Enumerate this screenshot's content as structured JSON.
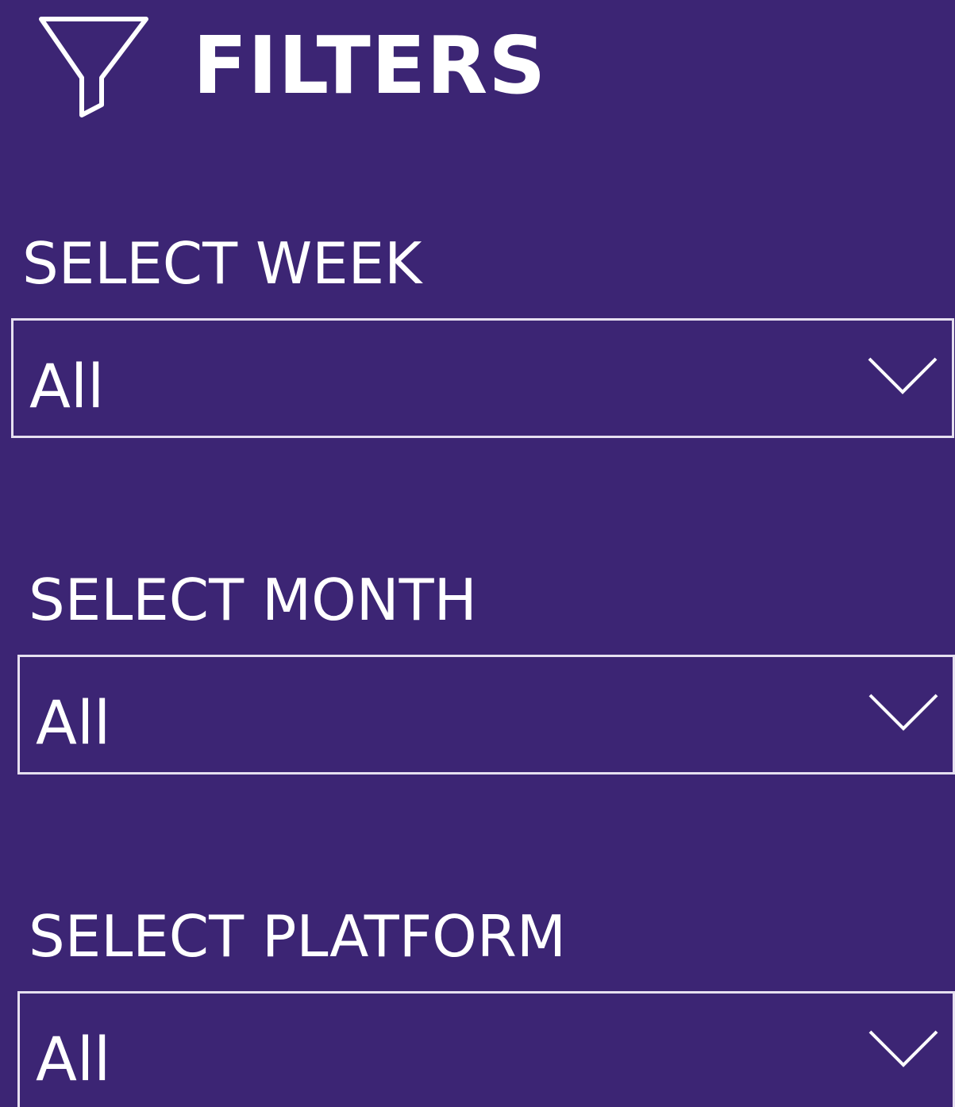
{
  "header": {
    "title": "FILTERS",
    "icon": "filter-funnel-icon"
  },
  "filters": [
    {
      "label": "SELECT WEEK",
      "value": "All"
    },
    {
      "label": "SELECT MONTH",
      "value": "All"
    },
    {
      "label": "SELECT PLATFORM",
      "value": "All"
    }
  ],
  "colors": {
    "background": "#3c2574",
    "text": "#ffffff",
    "border": "#e6e0f0"
  }
}
